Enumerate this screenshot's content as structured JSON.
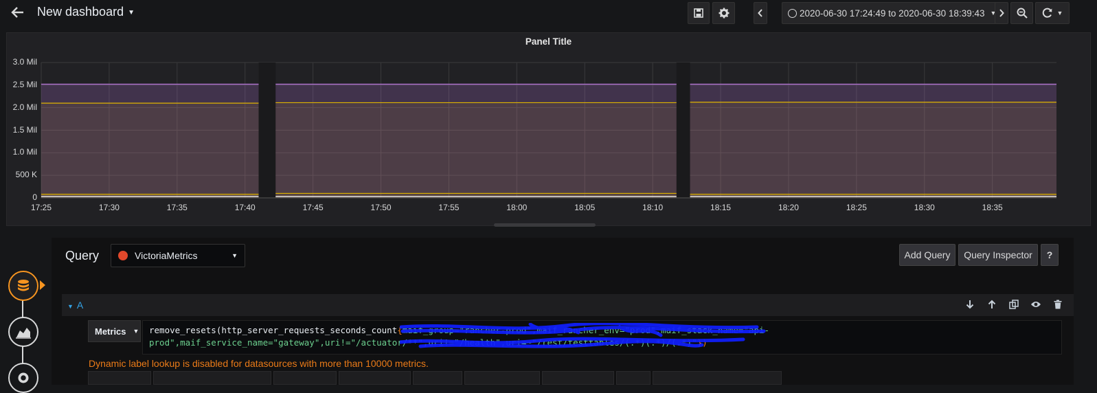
{
  "header": {
    "title": "New dashboard",
    "time_range": "2020-06-30 17:24:49 to 2020-06-30 18:39:43"
  },
  "icons": {
    "back": "arrow-left-icon",
    "save": "save-icon",
    "settings": "gear-icon",
    "prev": "chevron-left-icon",
    "next": "chevron-right-icon",
    "zoom": "zoom-out-icon",
    "refresh": "refresh-icon"
  },
  "chart_data": {
    "type": "area",
    "title": "Panel Title",
    "yticks": [
      "0",
      "500 K",
      "1.0 Mil",
      "1.5 Mil",
      "2.0 Mil",
      "2.5 Mil",
      "3.0 Mil"
    ],
    "ylim": [
      0,
      3000000
    ],
    "xticks": [
      "17:25",
      "17:30",
      "17:35",
      "17:40",
      "17:45",
      "17:50",
      "17:55",
      "18:00",
      "18:05",
      "18:10",
      "18:15",
      "18:20",
      "18:25",
      "18:30",
      "18:35"
    ],
    "x_minutes_from": "17:25",
    "segments": [
      {
        "start": "17:25",
        "end": "17:41"
      },
      {
        "start": "17:42:15",
        "end": "18:11:45"
      },
      {
        "start": "18:12:45",
        "end": "18:39:43"
      }
    ],
    "series": [
      {
        "values": [
          2520000,
          2520000,
          2520000
        ],
        "color": "#b877d9"
      },
      {
        "values": [
          2100000,
          2110000,
          2120000
        ],
        "color": "#e0b400"
      },
      {
        "values": [
          80000,
          100000,
          80000
        ],
        "color": "#e0b400"
      },
      {
        "values": [
          30000,
          30000,
          30000
        ],
        "color": "#ffffff"
      }
    ],
    "grid": true,
    "legend": "none"
  },
  "editor": {
    "title": "Query",
    "datasource": "VictoriaMetrics",
    "add_query": "Add Query",
    "query_inspector": "Query Inspector",
    "help": "?",
    "query_ref": "A",
    "metrics_label": "Metrics",
    "query_line1_fn": "remove_resets(http_server_requests_seconds_count",
    "query_line1_open": "{",
    "query_line1_rest": "maif_group=\"rancher-prod\",maif_rancher_env=\"prod\",maif_stack_name=\"api-",
    "query_line2_a": "prod\",maif_service_name=\"gateway\",uri!=\"/actuator/**\",",
    "query_line2_b": "uri!=\"/health\",uri=~\"/rest/testtables/(.*)(.*)/(.*)\"",
    "query_line2_close": "})",
    "warning": "Dynamic label lookup is disabled for datasources with more than 10000 metrics."
  }
}
